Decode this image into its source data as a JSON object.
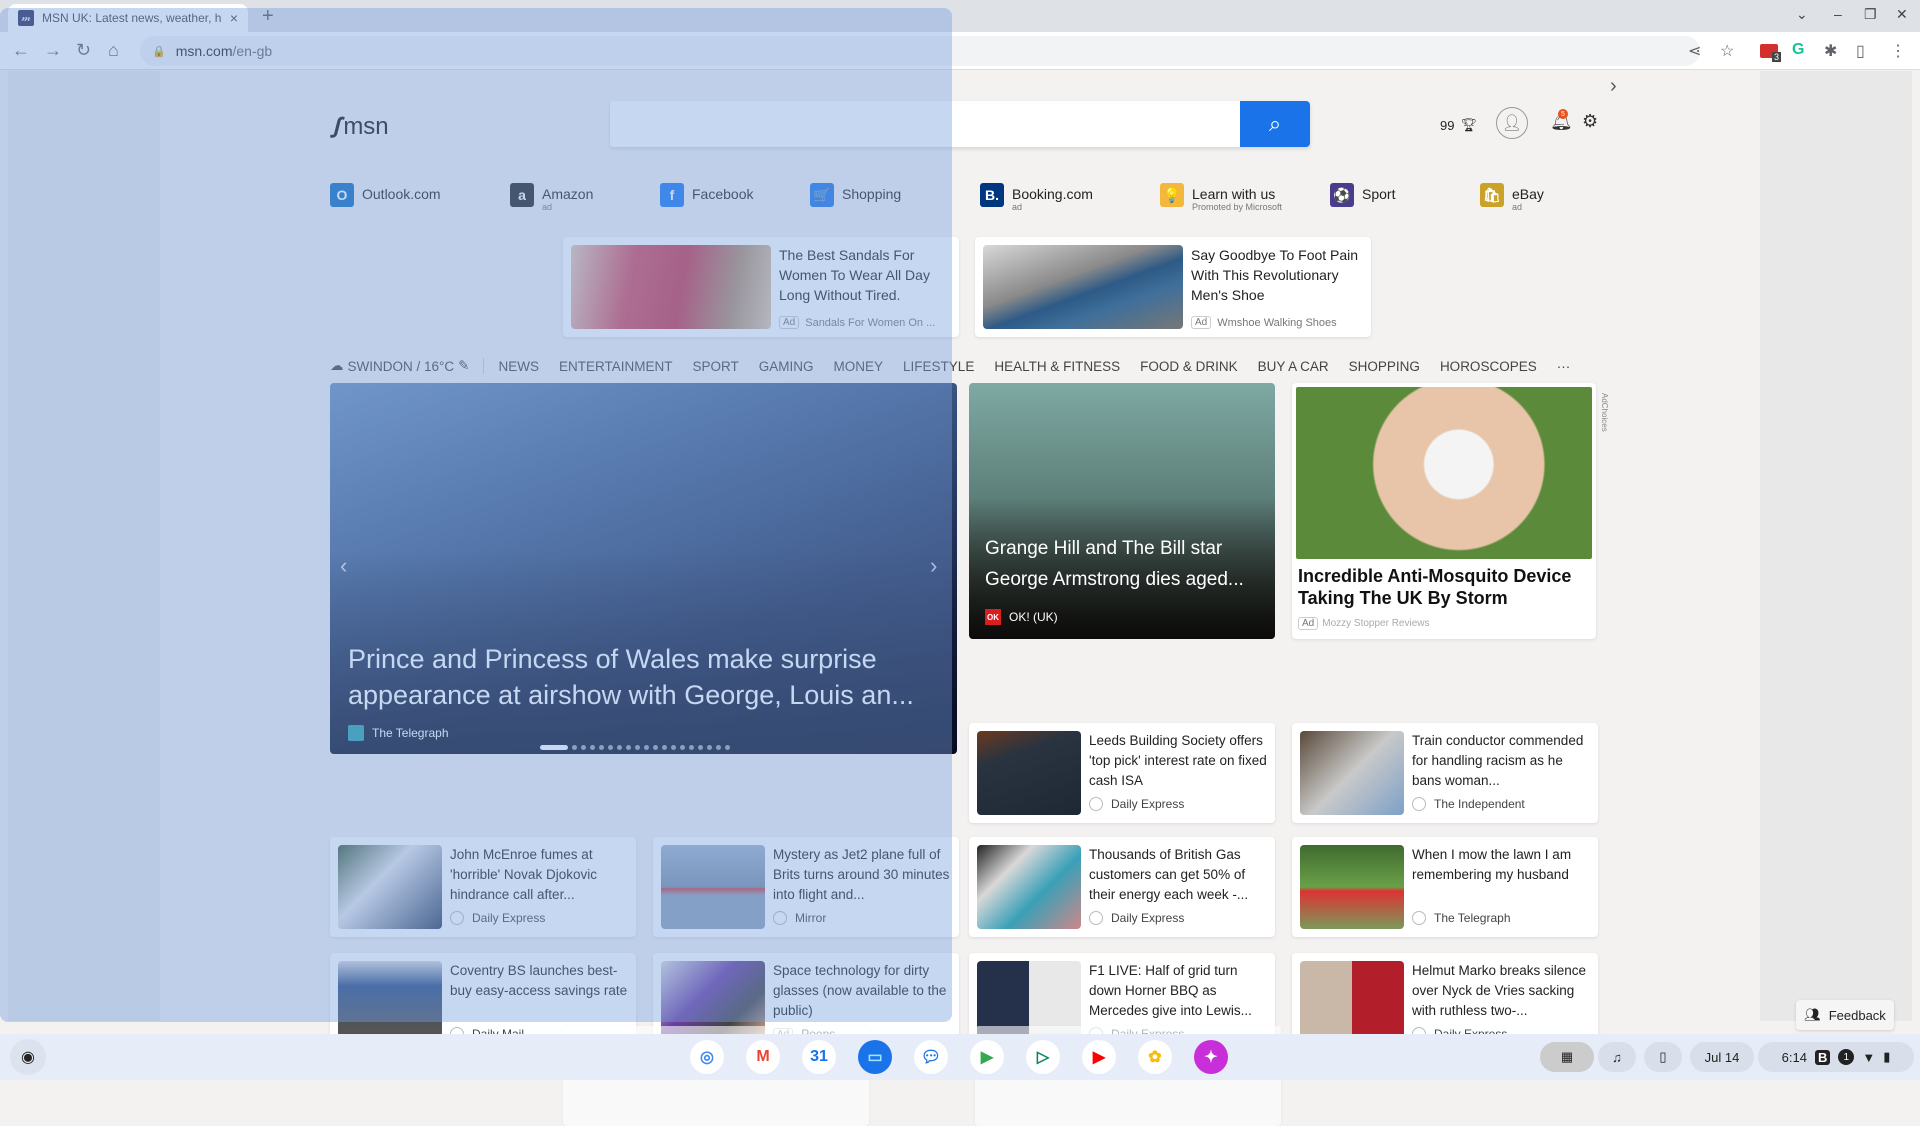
{
  "browser": {
    "tab_title": "MSN UK: Latest news, weather, h",
    "tab_close": "×",
    "new_tab": "+",
    "url_host": "msn.com",
    "url_path": "/en-gb",
    "extension_badge": "3",
    "window_controls": {
      "tabsearch": "⌄",
      "minimize": "–",
      "restore": "❐",
      "close": "✕"
    }
  },
  "msn": {
    "logo": "msn",
    "search_placeholder": "",
    "rewards_points": "99",
    "notification_count": "5"
  },
  "quick_links": [
    {
      "label": "Outlook.com",
      "sub": "",
      "icon": "O",
      "color": "#0f6cbd"
    },
    {
      "label": "Amazon",
      "sub": "ad",
      "icon": "a",
      "color": "#222222"
    },
    {
      "label": "Facebook",
      "sub": "",
      "icon": "f",
      "color": "#1877f2"
    },
    {
      "label": "Shopping",
      "sub": "",
      "icon": "🛒",
      "color": "#1a73e8"
    },
    {
      "label": "Booking.com",
      "sub": "ad",
      "icon": "B.",
      "color": "#003580"
    },
    {
      "label": "Learn with us",
      "sub": "Promoted by Microsoft",
      "icon": "💡",
      "color": "#f3b73b"
    },
    {
      "label": "Sport",
      "sub": "",
      "icon": "⚽",
      "color": "#4b3b8f"
    },
    {
      "label": "eBay",
      "sub": "ad",
      "icon": "🛍",
      "color": "#c9a227"
    }
  ],
  "top_ads": [
    {
      "title": "The Best Sandals For Women To Wear All Day Long Without Tired.",
      "ad_label": "Ad",
      "sponsor": "Sandals For Women On ..."
    },
    {
      "title": "Say Goodbye To Foot Pain With This Revolutionary Men's Shoe",
      "ad_label": "Ad",
      "sponsor": "Wmshoe Walking Shoes"
    }
  ],
  "nav": {
    "weather": "SWINDON / 16°C",
    "items": [
      "NEWS",
      "ENTERTAINMENT",
      "SPORT",
      "GAMING",
      "MONEY",
      "LIFESTYLE",
      "HEALTH & FITNESS",
      "FOOD & DRINK",
      "BUY A CAR",
      "SHOPPING",
      "HOROSCOPES"
    ],
    "more": "···"
  },
  "hero": {
    "title": "Prince and Princess of Wales make surprise appearance at airshow with George, Louis an...",
    "source": "The Telegraph",
    "slide_count": 19,
    "active_slide": 1
  },
  "feature": {
    "title": "Grange Hill and The Bill star George Armstrong dies aged...",
    "source": "OK! (UK)"
  },
  "sponsored": {
    "title": "Incredible Anti-Mosquito Device Taking The UK By Storm",
    "ad_label": "Ad",
    "sponsor": "Mozzy Stopper Reviews",
    "adchoices": "AdChoices"
  },
  "cards": [
    {
      "title": "John McEnroe fumes at 'horrible' Novak Djokovic hindrance call after...",
      "source": "Daily Express",
      "ad": false
    },
    {
      "title": "Mystery as Jet2 plane full of Brits turns around 30 minutes into flight and...",
      "source": "Mirror",
      "ad": false
    },
    {
      "title": "Leeds Building Society offers 'top pick' interest rate on fixed cash ISA",
      "source": "Daily Express",
      "ad": false
    },
    {
      "title": "Train conductor commended for handling racism as he bans woman...",
      "source": "The Independent",
      "ad": false
    },
    {
      "title": "Coventry BS launches best-buy easy-access savings rate",
      "source": "Daily Mail",
      "ad": false
    },
    {
      "title": "Space technology for dirty glasses (now available to the public)",
      "source": "Peeps",
      "ad": true,
      "ad_label": "Ad"
    },
    {
      "title": "Thousands of British Gas customers can get 50% of their energy each week -...",
      "source": "Daily Express",
      "ad": false
    },
    {
      "title": "When I mow the lawn I am remembering my husband",
      "source": "The Telegraph",
      "ad": false
    },
    {
      "title": "F1 LIVE: Half of grid turn down Horner BBQ as Mercedes give into Lewis...",
      "source": "Daily Express",
      "ad": false
    },
    {
      "title": "Helmut Marko breaks silence over Nyck de Vries sacking with ruthless two-...",
      "source": "Daily Express",
      "ad": false
    }
  ],
  "feedback": "Feedback",
  "shelf": {
    "apps": [
      "Chrome",
      "Gmail",
      "Calendar",
      "Files",
      "Messages",
      "Meet",
      "Play Store",
      "YouTube",
      "Photos",
      "Gallery"
    ],
    "date": "Jul 14",
    "time": "6:14",
    "notif_count": "1"
  }
}
